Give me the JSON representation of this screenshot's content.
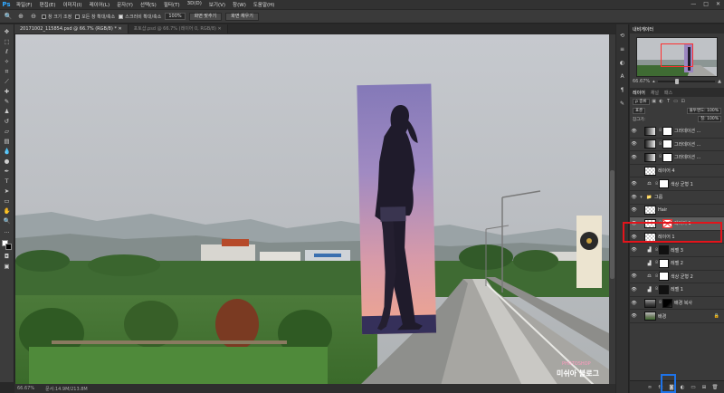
{
  "app": {
    "logo": "Ps",
    "menu": [
      "파일(F)",
      "편집(E)",
      "이미지(I)",
      "레이어(L)",
      "문자(Y)",
      "선택(S)",
      "필터(T)",
      "3D(D)",
      "보기(V)",
      "창(W)",
      "도움말(H)"
    ],
    "window_controls": [
      "—",
      "□",
      "✕"
    ]
  },
  "options_bar": {
    "check_resize": "창 크기 조정",
    "check_all_windows": "모든 창 확대/축소",
    "check_scrubby": "스크러비 확대/축소",
    "zoom_value": "100%",
    "fit_screen": "화면 맞추기",
    "fill_screen": "화면 채우기"
  },
  "tabs": [
    {
      "label": "20171002_115854.psd @ 66.7% (RGB/8) * ✕",
      "active": true
    },
    {
      "label": "포토샵.psd @ 66.7% (레이어 0, RGB/8) ✕",
      "active": false
    }
  ],
  "status": {
    "zoom": "66.67%",
    "doc": "문서:14.9M/213.8M"
  },
  "navigator": {
    "tab": "내비게이터",
    "zoom": "66.67%"
  },
  "layers_panel": {
    "tabs": [
      "레이어",
      "채널",
      "패스"
    ],
    "filter": "ρ 종류",
    "blend_mode": "표준",
    "opacity": "불투명도: 100%",
    "lock": "잠그기:",
    "fill": "칠: 100%",
    "layers": [
      {
        "name": "그라데이션 ...",
        "kind": "gradient"
      },
      {
        "name": "그라데이션 ...",
        "kind": "gradient"
      },
      {
        "name": "그라데이션 ...",
        "kind": "gradient"
      },
      {
        "name": "레이어 4",
        "kind": "blank"
      },
      {
        "name": "색상 균형 1",
        "kind": "adjust"
      },
      {
        "name": "그룹",
        "kind": "group"
      },
      {
        "name": "Hair",
        "kind": "hair"
      },
      {
        "name": "레이어 1",
        "kind": "selected"
      },
      {
        "name": "레이어 1",
        "kind": "person"
      },
      {
        "name": "레벨 3",
        "kind": "levels"
      },
      {
        "name": "레벨 2",
        "kind": "levels2"
      },
      {
        "name": "색상 균형 2",
        "kind": "adjust"
      },
      {
        "name": "레벨 1",
        "kind": "levels"
      },
      {
        "name": "배경 복사",
        "kind": "bgcopy"
      },
      {
        "name": "배경",
        "kind": "bg"
      }
    ]
  },
  "watermark": {
    "brand": "PHOTOSHOP",
    "title": "미쉬아 블로그"
  }
}
